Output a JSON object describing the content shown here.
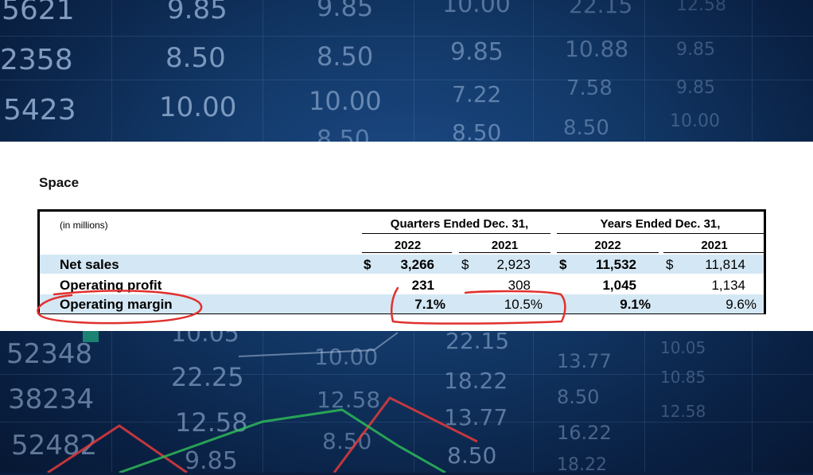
{
  "background": {
    "numbers": [
      "5621",
      "9.85",
      "9.85",
      "10.00",
      "22.15",
      "12.58",
      "2358",
      "8.50",
      "8.50",
      "9.85",
      "10.88",
      "9.85",
      "9.85",
      "5423",
      "10.00",
      "10.00",
      "7.22",
      "7.58",
      "9.85",
      "8.50",
      "10.00",
      "8.50",
      "52348",
      "10.05",
      "10.00",
      "22.15",
      "13.77",
      "10.05",
      "38234",
      "22.25",
      "12.58",
      "18.22",
      "8.50",
      "10.85",
      "52482",
      "12.58",
      "8.50",
      "13.77",
      "16.22",
      "12.58",
      "9.85",
      "8.50",
      "18.22"
    ]
  },
  "panel": {
    "section_title": "Space",
    "units_label": "(in millions)",
    "group_headers": [
      "Quarters Ended Dec. 31,",
      "Years Ended Dec. 31,"
    ],
    "year_headers": [
      "2022",
      "2021",
      "2022",
      "2021"
    ],
    "currency_symbol": "$",
    "rows": [
      {
        "label": "Net sales",
        "values": [
          "3,266",
          "2,923",
          "11,532",
          "11,814"
        ]
      },
      {
        "label": "Operating profit",
        "values": [
          "231",
          "308",
          "1,045",
          "1,134"
        ]
      },
      {
        "label": "Operating margin",
        "values": [
          "7.1%",
          "10.5%",
          "9.1%",
          "9.6%"
        ]
      }
    ]
  },
  "colors": {
    "row_shading": "#d4e7f4",
    "annotation": "#e0312f",
    "background_accent": "#123867"
  }
}
